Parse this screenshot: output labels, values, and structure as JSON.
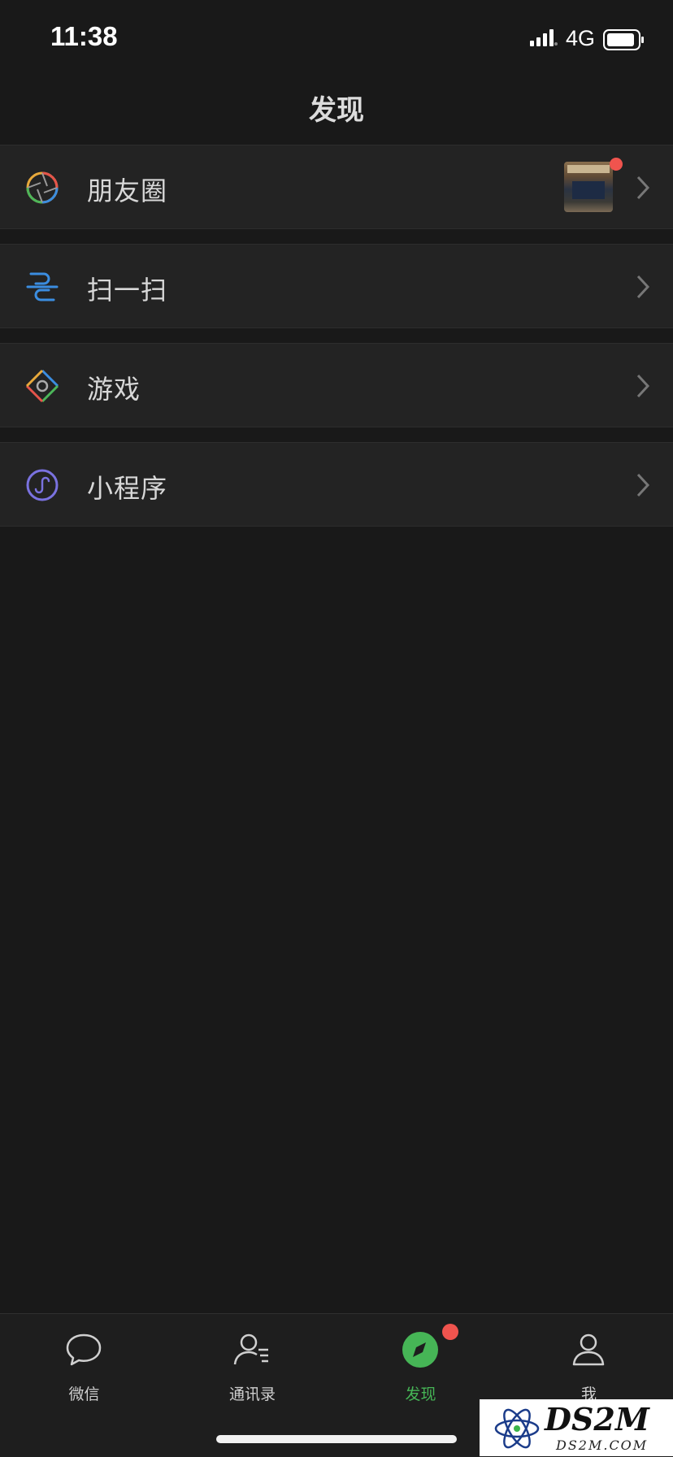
{
  "status_bar": {
    "time": "11:38",
    "network": "4G",
    "battery_icon": "battery-icon",
    "signal_icon": "signal-icon"
  },
  "header": {
    "title": "发现"
  },
  "menu": [
    {
      "label": "朋友圈",
      "icon": "moments-aperture-icon",
      "has_thumbnail": true,
      "has_badge": true
    },
    {
      "label": "扫一扫",
      "icon": "scan-icon"
    },
    {
      "label": "游戏",
      "icon": "games-diamond-icon"
    },
    {
      "label": "小程序",
      "icon": "mini-program-icon"
    }
  ],
  "tabs": [
    {
      "label": "微信",
      "icon": "chat-bubble-icon",
      "active": false
    },
    {
      "label": "通讯录",
      "icon": "contacts-icon",
      "active": false
    },
    {
      "label": "发现",
      "icon": "discover-compass-icon",
      "active": true,
      "badge": true
    },
    {
      "label": "我",
      "icon": "me-person-icon",
      "active": false
    }
  ],
  "watermark": {
    "text": "DS2M",
    "sub": "DS2M.COM"
  },
  "colors": {
    "background": "#191919",
    "row": "#232323",
    "accent": "#46b556",
    "badge": "#f0544e"
  }
}
